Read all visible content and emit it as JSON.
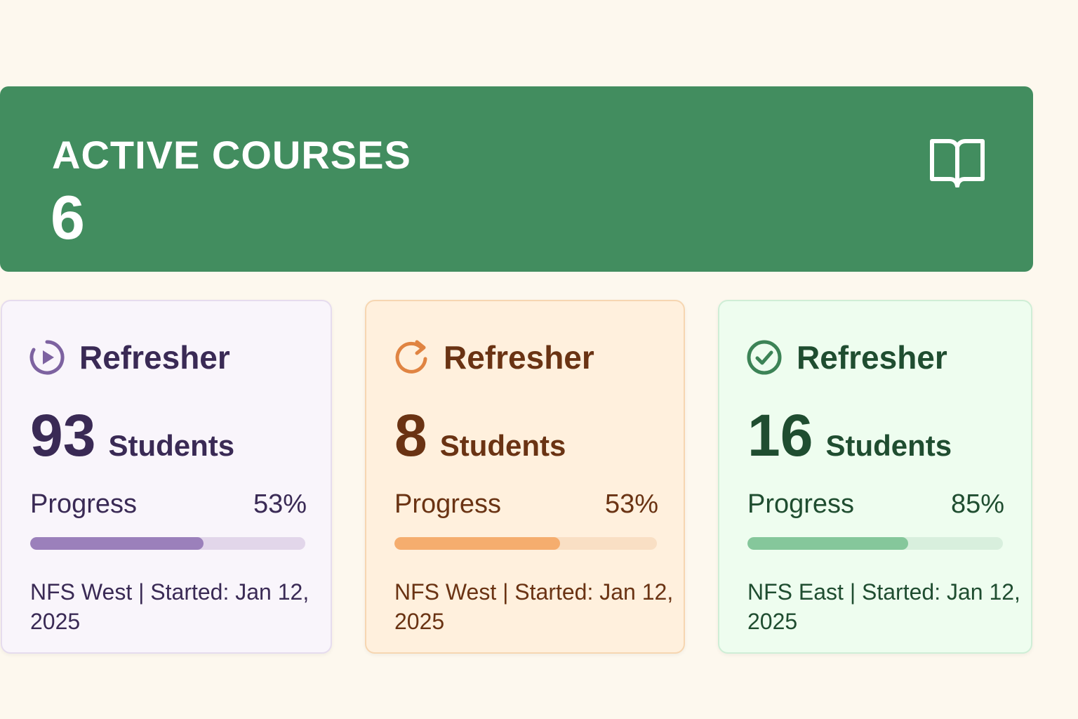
{
  "summary": {
    "title": "ACTIVE COURSES",
    "count": "6",
    "icon": "open-book-icon"
  },
  "cards": [
    {
      "title": "Refresher",
      "icon": "play-progress-icon",
      "students": "93",
      "students_label": "Students",
      "progress_label": "Progress",
      "progress_text": "53%",
      "progress_fill": 0.63,
      "meta": "NFS West | Started: Jan 12, 2025",
      "colors": {
        "accent": "#6f5490",
        "text": "#3a2a55",
        "bar": "#9b80bb",
        "track": "#e2d6ea",
        "bg": "#f9f5fb",
        "border": "#e6dcee"
      }
    },
    {
      "title": "Refresher",
      "icon": "refresh-icon",
      "students": "8",
      "students_label": "Students",
      "progress_label": "Progress",
      "progress_text": "53%",
      "progress_fill": 0.63,
      "meta": "NFS West | Started: Jan 12, 2025",
      "colors": {
        "accent": "#e08442",
        "text": "#6a3313",
        "bar": "#f5ad6e",
        "track": "#f9dfc4",
        "bg": "#fff0dd",
        "border": "#f6d6b1"
      }
    },
    {
      "title": "Refresher",
      "icon": "check-circle-icon",
      "students": "16",
      "students_label": "Students",
      "progress_label": "Progress",
      "progress_text": "85%",
      "progress_fill": 0.63,
      "meta": "NFS East | Started: Jan 12, 2025",
      "colors": {
        "accent": "#3c8356",
        "text": "#1f4d30",
        "bar": "#85c79b",
        "track": "#d8efdd",
        "bg": "#eefdef",
        "border": "#cfeed6"
      }
    }
  ]
}
